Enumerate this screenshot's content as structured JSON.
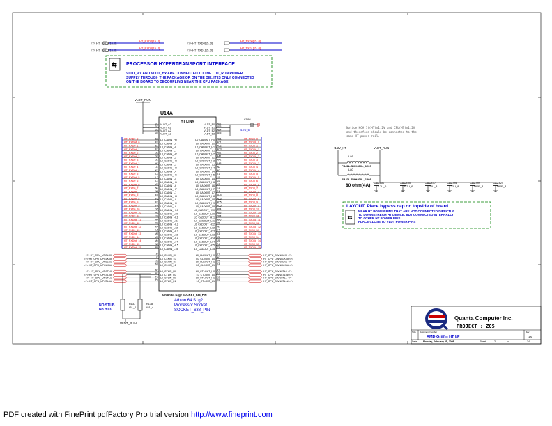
{
  "top_nets": {
    "left": [
      {
        "port": "<?> HT_RXD0[15..0]",
        "label": "HT_RXD0[15..0]"
      },
      {
        "port": "<?> HT_RXD1[15..0]",
        "label": "HT_RXD1[15..0]"
      }
    ],
    "right": [
      {
        "port": "<?> HT_TXD0[15..0]",
        "label": "HT_TXD0[15..0]"
      },
      {
        "port": "<?> HT_TXD1[15..0]",
        "label": "HT_TXD1[15..0]"
      }
    ]
  },
  "note1": {
    "title": "PROCESSOR HYPERTRANSPORT INTERFACE",
    "lines": [
      "VLDT_Ax AND VLDT_Bx ARE CONNECTED TO THE LDT_RUN POWER",
      "SUPPLY THROUGH THE PACKAGE OR ON THE DIE. IT IS ONLY CONNECTED",
      "ON THE BOARD TO DECOUPLING NEAR THE CPU PACKAGE"
    ]
  },
  "vldt_run": "VLDT_RUN",
  "chip": {
    "refdes": "U14A",
    "section": "HT LINK",
    "footer_line": "Athlon 64 S1g2 SOCKET_638_PIN",
    "desc": [
      "Athlon 64 S1g2",
      "Processor Socket",
      "SOCKET_638_PIN"
    ],
    "vldt_left": [
      {
        "pin": "D1",
        "name": "VLDT_A0"
      },
      {
        "pin": "D2",
        "name": "VLDT_A1"
      },
      {
        "pin": "D3",
        "name": "VLDT_A2"
      },
      {
        "pin": "D4",
        "name": "VLDT_A3"
      }
    ],
    "vldt_right": [
      {
        "pin": "AE2",
        "name": "VLDT_B0"
      },
      {
        "pin": "AE3",
        "name": "VLDT_B1"
      },
      {
        "pin": "AE4",
        "name": "VLDT_B2"
      },
      {
        "pin": "AE5",
        "name": "VLDT_B3"
      }
    ],
    "cad_left": [
      {
        "net": "HT_RXD0_0",
        "pin": "E3",
        "name": "L0_CADIN_H0"
      },
      {
        "net": "HT_RXD0#_0",
        "pin": "E2",
        "name": "L0_CADIN_L0"
      },
      {
        "net": "HT_RXD0_1",
        "pin": "E1",
        "name": "L0_CADIN_H1"
      },
      {
        "net": "HT_RXD0#_1",
        "pin": "F1",
        "name": "L0_CADIN_L1"
      },
      {
        "net": "HT_RXD0_2",
        "pin": "G3",
        "name": "L0_CADIN_H2"
      },
      {
        "net": "HT_RXD0#_2",
        "pin": "G2",
        "name": "L0_CADIN_L2"
      },
      {
        "net": "HT_RXD0_3",
        "pin": "G1",
        "name": "L0_CADIN_H3"
      },
      {
        "net": "HT_RXD0#_3",
        "pin": "H1",
        "name": "L0_CADIN_L3"
      },
      {
        "net": "HT_RXD0_4",
        "pin": "J1",
        "name": "L0_CADIN_H4"
      },
      {
        "net": "HT_RXD0#_4",
        "pin": "K1",
        "name": "L0_CADIN_L4"
      },
      {
        "net": "HT_RXD0_5",
        "pin": "L3",
        "name": "L0_CADIN_H5"
      },
      {
        "net": "HT_RXD0#_5",
        "pin": "L2",
        "name": "L0_CADIN_L5"
      },
      {
        "net": "HT_RXD0_6",
        "pin": "L1",
        "name": "L0_CADIN_H6"
      },
      {
        "net": "HT_RXD0#_6",
        "pin": "M1",
        "name": "L0_CADIN_L6"
      },
      {
        "net": "HT_RXD0_7",
        "pin": "N3",
        "name": "L0_CADIN_H7"
      },
      {
        "net": "HT_RXD0#_7",
        "pin": "N2",
        "name": "L0_CADIN_L7"
      },
      {
        "net": "HT_RXD0_8",
        "pin": "E5",
        "name": "L0_CADIN_H8"
      },
      {
        "net": "HT_RXD0#_8",
        "pin": "F5",
        "name": "L0_CADIN_L8"
      },
      {
        "net": "HT_RXD0_9",
        "pin": "F3",
        "name": "L0_CADIN_H9"
      },
      {
        "net": "HT_RXD0#_9",
        "pin": "F4",
        "name": "L0_CADIN_L9"
      },
      {
        "net": "HT_RXD0_10",
        "pin": "G5",
        "name": "L0_CADIN_H10"
      },
      {
        "net": "HT_RXD0#_10",
        "pin": "H5",
        "name": "L0_CADIN_L10"
      },
      {
        "net": "HT_RXD0_11",
        "pin": "H3",
        "name": "L0_CADIN_H11"
      },
      {
        "net": "HT_RXD0#_11",
        "pin": "H4",
        "name": "L0_CADIN_L11"
      },
      {
        "net": "HT_RXD0_12",
        "pin": "K3",
        "name": "L0_CADIN_H12"
      },
      {
        "net": "HT_RXD0#_12",
        "pin": "K4",
        "name": "L0_CADIN_L12"
      },
      {
        "net": "HT_RXD0_13",
        "pin": "L5",
        "name": "L0_CADIN_H13"
      },
      {
        "net": "HT_RXD0#_13",
        "pin": "M5",
        "name": "L0_CADIN_L13"
      },
      {
        "net": "HT_RXD0_14",
        "pin": "M3",
        "name": "L0_CADIN_H14"
      },
      {
        "net": "HT_RXD0#_14",
        "pin": "M4",
        "name": "L0_CADIN_L14"
      },
      {
        "net": "HT_RXD0_15",
        "pin": "N5",
        "name": "L0_CADIN_H15"
      },
      {
        "net": "HT_RXD0#_15",
        "pin": "P5",
        "name": "L0_CADIN_L15"
      }
    ],
    "cad_right": [
      {
        "net": "HT_TXD0_0",
        "pin": "AD1",
        "name": "L0_CADOUT_H0"
      },
      {
        "net": "HT_TXD0#_0",
        "pin": "AC1",
        "name": "L0_CADOUT_L0"
      },
      {
        "net": "HT_TXD0_1",
        "pin": "AC2",
        "name": "L0_CADOUT_H1"
      },
      {
        "net": "HT_TXD0#_1",
        "pin": "AC3",
        "name": "L0_CADOUT_L1"
      },
      {
        "net": "HT_TXD0_2",
        "pin": "AB1",
        "name": "L0_CADOUT_H2"
      },
      {
        "net": "HT_TXD0#_2",
        "pin": "AA1",
        "name": "L0_CADOUT_L2"
      },
      {
        "net": "HT_TXD0_3",
        "pin": "AA2",
        "name": "L0_CADOUT_H3"
      },
      {
        "net": "HT_TXD0#_3",
        "pin": "AA3",
        "name": "L0_CADOUT_L3"
      },
      {
        "net": "HT_TXD0_4",
        "pin": "W2",
        "name": "L0_CADOUT_H4"
      },
      {
        "net": "HT_TXD0#_4",
        "pin": "W3",
        "name": "L0_CADOUT_L4"
      },
      {
        "net": "HT_TXD0_5",
        "pin": "V1",
        "name": "L0_CADOUT_H5"
      },
      {
        "net": "HT_TXD0#_5",
        "pin": "U1",
        "name": "L0_CADOUT_L5"
      },
      {
        "net": "HT_TXD0_6",
        "pin": "U2",
        "name": "L0_CADOUT_H6"
      },
      {
        "net": "HT_TXD0#_6",
        "pin": "U3",
        "name": "L0_CADOUT_L6"
      },
      {
        "net": "HT_TXD0_7",
        "pin": "T1",
        "name": "L0_CADOUT_H7"
      },
      {
        "net": "HT_TXD0#_7",
        "pin": "R1",
        "name": "L0_CADOUT_L7"
      },
      {
        "net": "HT_TXD0_8",
        "pin": "AD4",
        "name": "L0_CADOUT_H8"
      },
      {
        "net": "HT_TXD0#_8",
        "pin": "AD3",
        "name": "L0_CADOUT_L8"
      },
      {
        "net": "HT_TXD0_9",
        "pin": "AD5",
        "name": "L0_CADOUT_H9"
      },
      {
        "net": "HT_TXD0#_9",
        "pin": "AC5",
        "name": "L0_CADOUT_L9"
      },
      {
        "net": "HT_TXD0_10",
        "pin": "AB4",
        "name": "L0_CADOUT_H10"
      },
      {
        "net": "HT_TXD0#_10",
        "pin": "AB3",
        "name": "L0_CADOUT_L10"
      },
      {
        "net": "HT_TXD0_11",
        "pin": "AB5",
        "name": "L0_CADOUT_H11"
      },
      {
        "net": "HT_TXD0#_11",
        "pin": "AA5",
        "name": "L0_CADOUT_L11"
      },
      {
        "net": "HT_TXD0_12",
        "pin": "Y5",
        "name": "L0_CADOUT_H12"
      },
      {
        "net": "HT_TXD0#_12",
        "pin": "W5",
        "name": "L0_CADOUT_L12"
      },
      {
        "net": "HT_TXD0_13",
        "pin": "V4",
        "name": "L0_CADOUT_H13"
      },
      {
        "net": "HT_TXD0#_13",
        "pin": "V3",
        "name": "L0_CADOUT_L13"
      },
      {
        "net": "HT_TXD0_14",
        "pin": "V5",
        "name": "L0_CADOUT_H14"
      },
      {
        "net": "HT_TXD0#_14",
        "pin": "U5",
        "name": "L0_CADOUT_L14"
      },
      {
        "net": "HT_TXD0_15",
        "pin": "T4",
        "name": "L0_CADOUT_H15"
      },
      {
        "net": "HT_TXD0#_15",
        "pin": "T3",
        "name": "L0_CADOUT_L15"
      }
    ],
    "clk_left": [
      {
        "port": "<?> HT_CPU_UPCLK0",
        "pin": "J3",
        "name": "L0_CLKIN_H0"
      },
      {
        "port": "<?> HT_CPU_UPCLK0#",
        "pin": "J2",
        "name": "L0_CLKIN_L0"
      },
      {
        "port": "<?> HT_CPU_UPCLK1",
        "pin": "J5",
        "name": "L0_CLKIN_H1"
      },
      {
        "port": "<?> HT_CPU_UPCLK1#",
        "pin": "K5",
        "name": "L0_CLKIN_L1"
      }
    ],
    "ctl_left": [
      {
        "port": "<?> HT_CPU_UPCTL0",
        "pin": "N1",
        "name": "L0_CTLIN_H0"
      },
      {
        "port": "<?> HT_CPU_UPCTL0#",
        "pin": "P1",
        "name": "L0_CTLIN_L0"
      },
      {
        "port": "<?> HT_CPU_UPCTL1",
        "pin": "P3",
        "name": "L0_CTLIN_H1"
      },
      {
        "port": "<?> HT_CPU_UPCTL1#",
        "pin": "P4",
        "name": "L0_CTLIN_L1"
      }
    ],
    "clk_right": [
      {
        "port": "HT_CPU_DWNCLK0 <?>",
        "pin": "Y1",
        "name": "L0_CLKOUT_H0"
      },
      {
        "port": "HT_CPU_DWNCLK0# <?>",
        "pin": "W1",
        "name": "L0_CLKOUT_L0"
      },
      {
        "port": "HT_CPU_DWNCLK1 <?>",
        "pin": "Y4",
        "name": "L0_CLKOUT_H1"
      },
      {
        "port": "HT_CPU_DWNCLK1# <?>",
        "pin": "Y3",
        "name": "L0_CLKOUT_L1"
      }
    ],
    "ctl_right": [
      {
        "port": "HT_CPU_DWNCTL0 <?>",
        "pin": "R2",
        "name": "L0_CTLOUT_H0"
      },
      {
        "port": "HT_CPU_DWNCTL0# <?>",
        "pin": "R3",
        "name": "L0_CTLOUT_L0"
      },
      {
        "port": "HT_CPU_DWNCTL1 <?>",
        "pin": "T5",
        "name": "L0_CTLOUT_H1"
      },
      {
        "port": "HT_CPU_DWNCTL1# <?>",
        "pin": "R5",
        "name": "L0_CTLOUT_L1"
      }
    ]
  },
  "c_top": {
    "ref": "C598",
    "value": "4.7U_6"
  },
  "stub": {
    "left_text": [
      "NO STUB",
      "No HT3"
    ],
    "r1": {
      "ref": "R137",
      "value": "*51_4"
    },
    "r2": {
      "ref": "R138",
      "value": "*51_4"
    },
    "net": "VLDT_RUN"
  },
  "power": {
    "note": [
      "Notice:HC#(1)(HT)=1.2V and CPU(HT)=1.2V",
      "and therefore should be connected to the",
      "same HT power rail."
    ],
    "vin": "+1.2V_HT",
    "vout": "VLDT_RUN",
    "l1": {
      "ref": "L86",
      "value": "FBJ2L-SMH400L_120S"
    },
    "l2": {
      "ref": "L80",
      "value": "FBJ2L-SMH400L_120S"
    },
    "rating": "80 ohm(4A)",
    "caps": [
      {
        "ref": "C451",
        "value": "4.7U_6"
      },
      {
        "ref": "C450",
        "value": "4.7U_6"
      },
      {
        "ref": "C437",
        "value": "22U_8"
      },
      {
        "ref": "C398",
        "value": "22U_8"
      },
      {
        "ref": "C399",
        "value": "180P_4"
      },
      {
        "ref": "C424",
        "value": "180P_4"
      }
    ]
  },
  "layout_note": {
    "title": "LAYOUT: Place bypass cap on topside of board",
    "lines": [
      "NEAR HT POWER PINS THAT ARE NOT CONNECTED DIRECTLY",
      "TO DOWNSTREAM HT DEVICE, BUT CONNECTED INTERNALLY",
      "TO OTHER HT POWER PINS",
      "PLACE CLOSE TO VLDT POWER PINS"
    ]
  },
  "title_block": {
    "company": "Quanta Computer Inc.",
    "project_label": "PROJECT : Z05",
    "size_label": "Size",
    "size": "",
    "docnum_label": "Document Number",
    "title": "AMD Griffin HT I/F",
    "rev_label": "Rev",
    "rev": "1A",
    "date_label": "Date:",
    "date": "Monday, February 25, 2008",
    "sheet_label": "Sheet",
    "sheet": "2",
    "of_label": "of",
    "total": "34"
  },
  "footer": {
    "text": "PDF created with FinePrint pdfFactory Pro trial version ",
    "link": "http://www.fineprint.com"
  },
  "colors": {
    "net": "#ff0000",
    "bus": "#0000cc",
    "line": "#000000",
    "dash": "#008000",
    "logo_blue": "#1a2a80",
    "logo_red": "#cc0000"
  }
}
